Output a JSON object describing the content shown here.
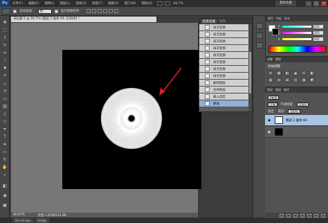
{
  "app": {
    "logo": "Ps"
  },
  "menu": [
    "文件(F)",
    "编辑(E)",
    "图像(I)",
    "图层(L)",
    "选择(S)",
    "滤镜(T)",
    "视图(V)",
    "窗口(W)",
    "帮助(H)"
  ],
  "menu_zoom": "66.7%",
  "workspace": "基本功能",
  "window_controls": {
    "minimize": "–",
    "maximize": "□",
    "close": "×"
  },
  "options_bar": {
    "auto_select_label": "自动选择：",
    "auto_select_value": "组",
    "show_transform_label": "显示变换控件"
  },
  "document": {
    "tab_title": "未标题-1 @ 66.7% (图层 2 副本 69, RGB/8) *",
    "zoom": "66.67%",
    "doc_size": "文档:1.61M/511.8K"
  },
  "bottom_tabs": [
    "Mini Bridge",
    "时间轴"
  ],
  "history": {
    "tabs": [
      "历史记录",
      "动作"
    ],
    "items": [
      {
        "label": "再次变换",
        "active": false
      },
      {
        "label": "再次变换",
        "active": false
      },
      {
        "label": "再次变换",
        "active": false
      },
      {
        "label": "再次变换",
        "active": false
      },
      {
        "label": "再次变换",
        "active": false
      },
      {
        "label": "再次变换",
        "active": false
      },
      {
        "label": "再次变换",
        "active": false
      },
      {
        "label": "再次变换",
        "active": false
      },
      {
        "label": "删除图层",
        "active": false
      },
      {
        "label": "合并图层",
        "active": false
      },
      {
        "label": "载入选区",
        "active": false
      },
      {
        "label": "移动",
        "active": true
      }
    ]
  },
  "color_panel": {
    "tabs": [
      "颜色",
      "色板",
      "样式"
    ],
    "channels": [
      {
        "label": "R",
        "value": "255"
      },
      {
        "label": "G",
        "value": "255"
      },
      {
        "label": "B",
        "value": "255"
      }
    ]
  },
  "adjustments": {
    "tabs": [
      "调整",
      "蒙版"
    ],
    "title": "添加调整",
    "icons": [
      "☀",
      "▦",
      "◐",
      "▲",
      "▽",
      "◧",
      "▤",
      "◎",
      "⊞",
      "◫",
      "▨",
      "◩"
    ]
  },
  "layers_panel": {
    "tabs": [
      "图层",
      "通道",
      "路径"
    ],
    "kind_label": "P类型",
    "blend_mode": "正常",
    "opacity_label": "不透明度:",
    "opacity_value": "100%",
    "lock_label": "锁定:",
    "fill_label": "填充:",
    "fill_value": "100%",
    "layers": [
      {
        "name": "图层 2 副本 69",
        "selected": true,
        "thumb": "white"
      },
      {
        "name": "",
        "selected": false,
        "thumb": "black"
      }
    ]
  },
  "annotation": {
    "arrow_color": "#e02020"
  }
}
